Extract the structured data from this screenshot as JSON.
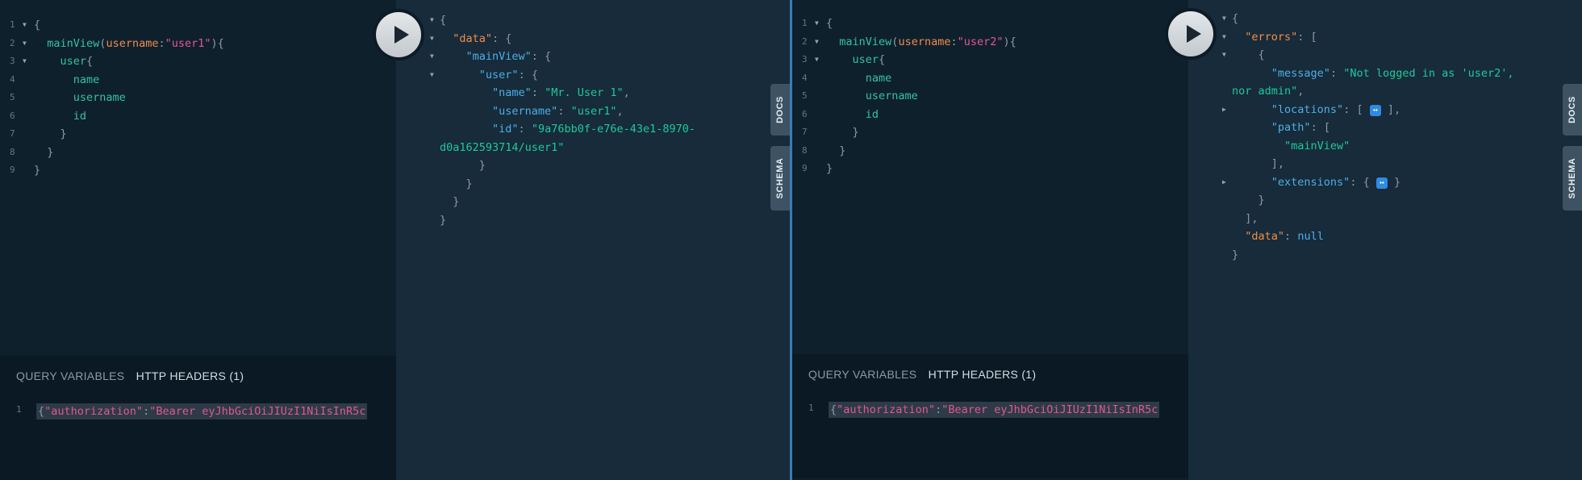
{
  "left": {
    "query_lines": [
      {
        "num": "1",
        "parts": [
          [
            "p",
            "{"
          ]
        ]
      },
      {
        "num": "2",
        "parts": [
          [
            "p",
            "  "
          ],
          [
            "f",
            "mainView"
          ],
          [
            "p",
            "("
          ],
          [
            "a",
            "username"
          ],
          [
            "p",
            ":"
          ],
          [
            "s",
            "\"user1\""
          ],
          [
            "p",
            "){"
          ]
        ]
      },
      {
        "num": "3",
        "parts": [
          [
            "p",
            "    "
          ],
          [
            "f",
            "user"
          ],
          [
            "p",
            "{"
          ]
        ]
      },
      {
        "num": "4",
        "parts": [
          [
            "p",
            "      "
          ],
          [
            "f",
            "name"
          ]
        ]
      },
      {
        "num": "5",
        "parts": [
          [
            "p",
            "      "
          ],
          [
            "f",
            "username"
          ]
        ]
      },
      {
        "num": "6",
        "parts": [
          [
            "p",
            "      "
          ],
          [
            "f",
            "id"
          ]
        ]
      },
      {
        "num": "7",
        "parts": [
          [
            "p",
            "    }"
          ]
        ]
      },
      {
        "num": "8",
        "parts": [
          [
            "p",
            "  }"
          ]
        ]
      },
      {
        "num": "9",
        "parts": [
          [
            "p",
            "}"
          ]
        ]
      }
    ],
    "query_folds": [
      true,
      true,
      true,
      false,
      false,
      false,
      false,
      false,
      false
    ],
    "result_lines": [
      {
        "fold": true,
        "parts": [
          [
            "p",
            "{"
          ]
        ]
      },
      {
        "fold": true,
        "parts": [
          [
            "p",
            "  "
          ],
          [
            "a",
            "\"data\""
          ],
          [
            "p",
            ": {"
          ]
        ]
      },
      {
        "fold": true,
        "parts": [
          [
            "p",
            "    "
          ],
          [
            "k",
            "\"mainView\""
          ],
          [
            "p",
            ": {"
          ]
        ]
      },
      {
        "fold": true,
        "parts": [
          [
            "p",
            "      "
          ],
          [
            "k",
            "\"user\""
          ],
          [
            "p",
            ": {"
          ]
        ]
      },
      {
        "fold": false,
        "parts": [
          [
            "p",
            "        "
          ],
          [
            "k",
            "\"name\""
          ],
          [
            "p",
            ": "
          ],
          [
            "v",
            "\"Mr. User 1\""
          ],
          [
            "p",
            ","
          ]
        ]
      },
      {
        "fold": false,
        "parts": [
          [
            "p",
            "        "
          ],
          [
            "k",
            "\"username\""
          ],
          [
            "p",
            ": "
          ],
          [
            "v",
            "\"user1\""
          ],
          [
            "p",
            ","
          ]
        ]
      },
      {
        "fold": false,
        "parts": [
          [
            "p",
            "        "
          ],
          [
            "k",
            "\"id\""
          ],
          [
            "p",
            ": "
          ],
          [
            "v",
            "\"9a76bb0f-e76e-43e1-8970-"
          ]
        ]
      },
      {
        "fold": false,
        "parts": [
          [
            "v",
            "d0a162593714/user1\""
          ]
        ]
      },
      {
        "fold": false,
        "parts": [
          [
            "p",
            "      }"
          ]
        ]
      },
      {
        "fold": false,
        "parts": [
          [
            "p",
            "    }"
          ]
        ]
      },
      {
        "fold": false,
        "parts": [
          [
            "p",
            "  }"
          ]
        ]
      },
      {
        "fold": false,
        "parts": [
          [
            "p",
            "}"
          ]
        ]
      }
    ],
    "vars_tab_query": "QUERY VARIABLES",
    "vars_tab_headers": "HTTP HEADERS (1)",
    "header_line_num": "1",
    "header_parts": [
      [
        "p",
        "{"
      ],
      [
        "s",
        "\"authorization\""
      ],
      [
        "p",
        ":"
      ],
      [
        "s",
        "\"Bearer eyJhbGciOiJIUzI1NiIsInR5c"
      ]
    ]
  },
  "right": {
    "query_lines": [
      {
        "num": "1",
        "parts": [
          [
            "p",
            "{"
          ]
        ]
      },
      {
        "num": "2",
        "parts": [
          [
            "p",
            "  "
          ],
          [
            "f",
            "mainView"
          ],
          [
            "p",
            "("
          ],
          [
            "a",
            "username"
          ],
          [
            "p",
            ":"
          ],
          [
            "s",
            "\"user2\""
          ],
          [
            "p",
            "){"
          ]
        ]
      },
      {
        "num": "3",
        "parts": [
          [
            "p",
            "    "
          ],
          [
            "f",
            "user"
          ],
          [
            "p",
            "{"
          ]
        ]
      },
      {
        "num": "4",
        "parts": [
          [
            "p",
            "      "
          ],
          [
            "f",
            "name"
          ]
        ]
      },
      {
        "num": "5",
        "parts": [
          [
            "p",
            "      "
          ],
          [
            "f",
            "username"
          ]
        ]
      },
      {
        "num": "6",
        "parts": [
          [
            "p",
            "      "
          ],
          [
            "f",
            "id"
          ]
        ]
      },
      {
        "num": "7",
        "parts": [
          [
            "p",
            "    }"
          ]
        ]
      },
      {
        "num": "8",
        "parts": [
          [
            "p",
            "  }"
          ]
        ]
      },
      {
        "num": "9",
        "parts": [
          [
            "p",
            "}"
          ]
        ]
      }
    ],
    "query_folds": [
      true,
      true,
      true,
      false,
      false,
      false,
      false,
      false,
      false
    ],
    "result_lines": [
      {
        "fold": "down",
        "parts": [
          [
            "p",
            "{"
          ]
        ]
      },
      {
        "fold": "down",
        "parts": [
          [
            "p",
            "  "
          ],
          [
            "a",
            "\"errors\""
          ],
          [
            "p",
            ": ["
          ]
        ]
      },
      {
        "fold": "down",
        "parts": [
          [
            "p",
            "    {"
          ]
        ]
      },
      {
        "fold": "",
        "parts": [
          [
            "p",
            "      "
          ],
          [
            "k",
            "\"message\""
          ],
          [
            "p",
            ": "
          ],
          [
            "v",
            "\"Not logged in as 'user2',"
          ]
        ]
      },
      {
        "fold": "",
        "parts": [
          [
            "v",
            "nor admin\""
          ],
          [
            "p",
            ","
          ]
        ]
      },
      {
        "fold": "right",
        "parts": [
          [
            "p",
            "      "
          ],
          [
            "k",
            "\"locations\""
          ],
          [
            "p",
            ": [ "
          ],
          [
            "badge",
            "↔"
          ],
          [
            "p",
            " ],"
          ]
        ]
      },
      {
        "fold": "",
        "parts": [
          [
            "p",
            "      "
          ],
          [
            "k",
            "\"path\""
          ],
          [
            "p",
            ": ["
          ]
        ]
      },
      {
        "fold": "",
        "parts": [
          [
            "p",
            "        "
          ],
          [
            "v",
            "\"mainView\""
          ]
        ]
      },
      {
        "fold": "",
        "parts": [
          [
            "p",
            "      ],"
          ]
        ]
      },
      {
        "fold": "right",
        "parts": [
          [
            "p",
            "      "
          ],
          [
            "k",
            "\"extensions\""
          ],
          [
            "p",
            ": { "
          ],
          [
            "badge",
            "↔"
          ],
          [
            "p",
            " }"
          ]
        ]
      },
      {
        "fold": "",
        "parts": [
          [
            "p",
            "    }"
          ]
        ]
      },
      {
        "fold": "",
        "parts": [
          [
            "p",
            "  ],"
          ]
        ]
      },
      {
        "fold": "",
        "parts": [
          [
            "p",
            "  "
          ],
          [
            "a",
            "\"data\""
          ],
          [
            "p",
            ": "
          ],
          [
            "n",
            "null"
          ]
        ]
      },
      {
        "fold": "",
        "parts": [
          [
            "p",
            "}"
          ]
        ]
      }
    ],
    "vars_tab_query": "QUERY VARIABLES",
    "vars_tab_headers": "HTTP HEADERS (1)",
    "header_line_num": "1",
    "header_parts": [
      [
        "p",
        "{"
      ],
      [
        "s",
        "\"authorization\""
      ],
      [
        "p",
        ":"
      ],
      [
        "s",
        "\"Bearer eyJhbGciOiJIUzI1NiIsInR5c"
      ]
    ]
  },
  "side_tabs": {
    "docs": "DOCS",
    "schema": "SCHEMA"
  },
  "icons": {
    "execute": "play-icon"
  },
  "colors": {
    "background": "#0f202d",
    "result_bg": "#172b3a",
    "divider": "#3a7bb8",
    "field": "#35c2a0",
    "argument": "#f08d49",
    "string": "#e4568f",
    "key": "#4dafe7",
    "value": "#1fc99b"
  }
}
